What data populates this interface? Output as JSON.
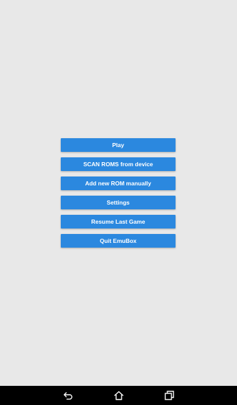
{
  "menu": {
    "items": [
      {
        "label": "Play"
      },
      {
        "label": "SCAN ROMS from device"
      },
      {
        "label": "Add new ROM manually"
      },
      {
        "label": "Settings"
      },
      {
        "label": "Resume Last Game"
      },
      {
        "label": "Quit EmuBox"
      }
    ]
  },
  "colors": {
    "background": "#e8e8e8",
    "button": "#2b88df",
    "button_text": "#ffffff",
    "navbar": "#000000"
  },
  "navbar": {
    "icons": [
      "back-icon",
      "home-icon",
      "recent-apps-icon"
    ]
  }
}
